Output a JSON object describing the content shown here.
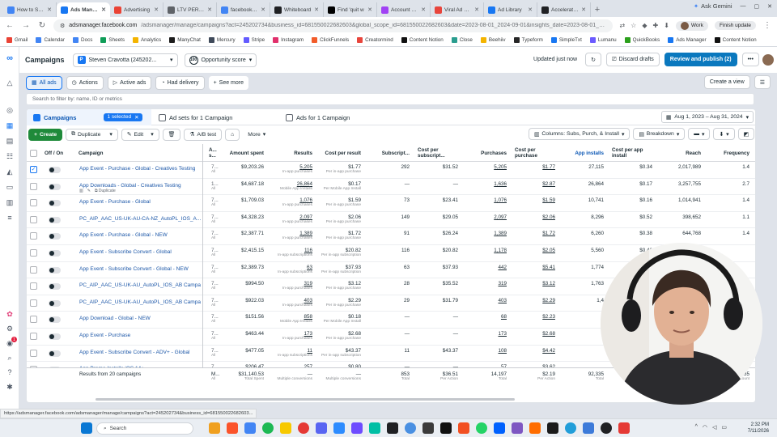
{
  "browser": {
    "tabs": [
      {
        "label": "How to Scale",
        "color": "#4285f4",
        "active": false
      },
      {
        "label": "Ads Manager",
        "color": "#1877f2",
        "active": true
      },
      {
        "label": "Advertising",
        "color": "#ea4335",
        "active": false
      },
      {
        "label": "LTV PER INS",
        "color": "#5f6368",
        "active": false
      },
      {
        "label": "facebook en",
        "color": "#4285f4",
        "active": false
      },
      {
        "label": "Whiteboard",
        "color": "#202124",
        "active": false
      },
      {
        "label": "Find 'quit w",
        "color": "#000000",
        "active": false
      },
      {
        "label": "Account Set",
        "color": "#a142f4",
        "active": false
      },
      {
        "label": "Viral Ad Libr",
        "color": "#e8453c",
        "active": false
      },
      {
        "label": "Ad Library",
        "color": "#1877f2",
        "active": false
      },
      {
        "label": "Accelerate y",
        "color": "#202124",
        "active": false
      }
    ],
    "ask_label": "Ask Gemini",
    "url_base": "adsmanager.facebook.com",
    "url_rest": "/adsmanager/manage/campaigns?act=245202734&business_id=681550022682603&global_scope_id=681550022682603&date=2023-08-01_2024-09-01&insights_date=2023-08-01_2024-08-31",
    "profile_label": "Work",
    "finish_label": "Finish update",
    "bookmarks": [
      {
        "label": "Gmail",
        "color": "#ea4335"
      },
      {
        "label": "Calendar",
        "color": "#4285f4"
      },
      {
        "label": "Docs",
        "color": "#4285f4"
      },
      {
        "label": "Sheets",
        "color": "#0f9d58"
      },
      {
        "label": "Analytics",
        "color": "#f4b400"
      },
      {
        "label": "ManyChat",
        "color": "#1c1c1c"
      },
      {
        "label": "Mercury",
        "color": "#3f4a5a"
      },
      {
        "label": "Stripe",
        "color": "#635bff"
      },
      {
        "label": "Instagram",
        "color": "#e1306c"
      },
      {
        "label": "ClickFunnels",
        "color": "#f25c2a"
      },
      {
        "label": "Creatormind",
        "color": "#e8453c"
      },
      {
        "label": "Content Notion",
        "color": "#111111"
      },
      {
        "label": "Close",
        "color": "#2a9d8f"
      },
      {
        "label": "Beehiiv",
        "color": "#f4b400"
      },
      {
        "label": "Typeform",
        "color": "#262627"
      },
      {
        "label": "SimpleTxt",
        "color": "#1877f2"
      },
      {
        "label": "Lumanu",
        "color": "#6b5bff"
      },
      {
        "label": "QuickBooks",
        "color": "#2ca01c"
      },
      {
        "label": "Ads Manager",
        "color": "#1877f2"
      },
      {
        "label": "Content Notion",
        "color": "#111111"
      }
    ]
  },
  "header": {
    "title": "Campaigns",
    "account": "Steven Cravotta (245202...",
    "opportunity": "Opportunity score",
    "opportunity_badge": "100",
    "updated": "Updated just now",
    "discard": "Discard drafts",
    "review": "Review and publish (2)"
  },
  "filters": {
    "tabs": [
      "All ads",
      "Actions",
      "Active ads",
      "Had delivery"
    ],
    "see_more": "See more",
    "create_view": "Create a view"
  },
  "search": {
    "placeholder": "Search to filter by: name, ID or metrics"
  },
  "levels": {
    "campaigns": "Campaigns",
    "selected": "1 selected",
    "adsets": "Ad sets for 1 Campaign",
    "ads": "Ads for 1 Campaign",
    "date_range": "Aug 1, 2023 – Aug 31, 2024"
  },
  "actions": {
    "create": "Create",
    "duplicate": "Duplicate",
    "edit": "Edit",
    "ab_test": "A/B test",
    "more": "More",
    "columns": "Columns: Subs, Purch, & Install",
    "breakdown": "Breakdown"
  },
  "table": {
    "headers": [
      "Off / On",
      "Campaign",
      "A... s...",
      "Amount spent",
      "Results",
      "Cost per result",
      "Subscript...",
      "Cost per subscript...",
      "Purchases",
      "Cost per purchase",
      "App installs",
      "Cost per app install",
      "Reach",
      "Frequency"
    ],
    "row_tools": [
      "Duplicate"
    ],
    "rows": [
      {
        "name": "App Event - Purchase - Global - Creatives Testing",
        "st": "7...",
        "st_sub": "All",
        "spent": "$9,203.26",
        "results": "5,205",
        "results_sub": "In-app purchases",
        "cpr": "$1.77",
        "cpr_sub": "Per in-app purchase",
        "subs": "292",
        "cps": "$31.52",
        "purch": "5,205",
        "cpp": "$1.77",
        "installs": "27,115",
        "cpi": "$0.34",
        "reach": "2,017,989",
        "freq": "1.4",
        "checked": true
      },
      {
        "name": "App Downloads - Global - Creatives Testing",
        "st": "1...",
        "st_sub": "All",
        "spent": "$4,687.18",
        "results": "26,864",
        "results_sub": "Mobile App Installs",
        "cpr": "$0.17",
        "cpr_sub": "Per Mobile App Install",
        "subs": "—",
        "cps": "—",
        "purch": "1,636",
        "cpp": "$2.87",
        "installs": "26,864",
        "cpi": "$0.17",
        "reach": "3,257,755",
        "freq": "2.7",
        "checked": false
      },
      {
        "name": "App Event - Purchase - Global",
        "st": "7...",
        "st_sub": "All",
        "spent": "$1,709.03",
        "results": "1,076",
        "results_sub": "In-app purchases",
        "cpr": "$1.59",
        "cpr_sub": "Per in-app purchase",
        "subs": "73",
        "cps": "$23.41",
        "purch": "1,076",
        "cpp": "$1.59",
        "installs": "10,741",
        "cpi": "$0.16",
        "reach": "1,014,941",
        "freq": "1.4",
        "checked": false
      },
      {
        "name": "PC_AIP_AAC_US-UK-AU-CA-NZ_AutoPL_IOS_A...",
        "st": "7...",
        "st_sub": "All",
        "spent": "$4,328.23",
        "results": "2,097",
        "results_sub": "In-app purchases",
        "cpr": "$2.06",
        "cpr_sub": "Per in-app purchase",
        "subs": "149",
        "cps": "$29.05",
        "purch": "2,097",
        "cpp": "$2.06",
        "installs": "8,296",
        "cpi": "$0.52",
        "reach": "398,652",
        "freq": "1.1",
        "checked": false
      },
      {
        "name": "App Event - Purchase - Global - NEW",
        "st": "7...",
        "st_sub": "All",
        "spent": "$2,387.71",
        "results": "1,389",
        "results_sub": "In-app purchases",
        "cpr": "$1.72",
        "cpr_sub": "Per in-app purchase",
        "subs": "91",
        "cps": "$26.24",
        "purch": "1,389",
        "cpp": "$1.72",
        "installs": "6,260",
        "cpi": "$0.38",
        "reach": "644,768",
        "freq": "1.4",
        "checked": false
      },
      {
        "name": "App Event - Subscribe Convert - Global",
        "st": "7...",
        "st_sub": "All",
        "spent": "$2,415.15",
        "results": "116",
        "results_sub": "In-app subscriptions",
        "cpr": "$20.82",
        "cpr_sub": "Per in-app subscription",
        "subs": "116",
        "cps": "$20.82",
        "purch": "1,178",
        "cpp": "$2.05",
        "installs": "5,560",
        "cpi": "$0.43",
        "reach": "",
        "freq": "",
        "checked": false
      },
      {
        "name": "App Event - Subscribe Convert - Global - NEW",
        "st": "7...",
        "st_sub": "All",
        "spent": "$2,389.73",
        "results": "63",
        "results_sub": "In-app subscriptions",
        "cpr": "$37.93",
        "cpr_sub": "Per in-app subscription",
        "subs": "63",
        "cps": "$37.93",
        "purch": "442",
        "cpp": "$5.41",
        "installs": "1,774",
        "cpi": "",
        "reach": "",
        "freq": "",
        "checked": false
      },
      {
        "name": "PC_AIP_AAC_US-UK-AU_AutoPL_IOS_AB Campaign",
        "st": "7...",
        "st_sub": "All",
        "spent": "$994.50",
        "results": "319",
        "results_sub": "In-app purchases",
        "cpr": "$3.12",
        "cpr_sub": "Per in-app purchase",
        "subs": "28",
        "cps": "$35.52",
        "purch": "319",
        "cpp": "$3.12",
        "installs": "1,763",
        "cpi": "",
        "reach": "",
        "freq": "",
        "checked": false
      },
      {
        "name": "PC_AIP_AAC_US-UK-AU_AutoPL_IOS_AB Campaign...",
        "st": "7...",
        "st_sub": "All",
        "spent": "$922.03",
        "results": "403",
        "results_sub": "In-app purchases",
        "cpr": "$2.29",
        "cpr_sub": "Per in-app purchase",
        "subs": "29",
        "cps": "$31.79",
        "purch": "403",
        "cpp": "$2.29",
        "installs": "1,4",
        "cpi": "",
        "reach": "",
        "freq": "",
        "checked": false
      },
      {
        "name": "App Download - Global - NEW",
        "st": "7...",
        "st_sub": "All",
        "spent": "$151.56",
        "results": "858",
        "results_sub": "Mobile App Installs",
        "cpr": "$0.18",
        "cpr_sub": "Per Mobile App Install",
        "subs": "—",
        "cps": "—",
        "purch": "68",
        "cpp": "$2.23",
        "installs": "",
        "cpi": "",
        "reach": "",
        "freq": "",
        "checked": false
      },
      {
        "name": "App Event - Purchase",
        "st": "7...",
        "st_sub": "All",
        "spent": "$463.44",
        "results": "173",
        "results_sub": "In-app purchases",
        "cpr": "$2.68",
        "cpr_sub": "Per in-app purchase",
        "subs": "—",
        "cps": "—",
        "purch": "173",
        "cpp": "$2.68",
        "installs": "",
        "cpi": "",
        "reach": "",
        "freq": "",
        "checked": false
      },
      {
        "name": "App Event - Subscribe Convert - ADV+ - Global",
        "st": "7...",
        "st_sub": "All",
        "spent": "$477.05",
        "results": "11",
        "results_sub": "In-app subscriptions",
        "cpr": "$43.37",
        "cpr_sub": "Per in-app subscription",
        "subs": "11",
        "cps": "$43.37",
        "purch": "108",
        "cpp": "$4.42",
        "installs": "",
        "cpi": "",
        "reach": "",
        "freq": "",
        "checked": false
      },
      {
        "name": "App Promo Installs iOS 14+",
        "st": "7...",
        "st_sub": "",
        "spent": "$206.47",
        "results": "257",
        "results_sub": "",
        "cpr": "$0.80",
        "cpr_sub": "",
        "subs": "—",
        "cps": "—",
        "purch": "57",
        "cpp": "$3.62",
        "installs": "",
        "cpi": "",
        "reach": "",
        "freq": "",
        "checked": false
      }
    ],
    "totals": {
      "label": "Results from 20 campaigns",
      "st": "M...",
      "st_sub": "All",
      "spent": "$31,140.53",
      "spent_sub": "Total Spent",
      "results": "—",
      "results_sub": "Multiple conversions",
      "cpr": "—",
      "cpr_sub": "Multiple conversions",
      "subs": "853",
      "subs_sub": "Total",
      "cps": "$36.51",
      "cps_sub": "Per Action",
      "purch": "14,197",
      "purch_sub": "Total",
      "cpp": "$2.19",
      "cpp_sub": "Per Action",
      "installs": "92,335",
      "installs_sub": "Total",
      "cpi": "",
      "reach": "",
      "freq": "2.85",
      "freq_sub": "Account"
    }
  },
  "status_url": "https://adsmanager.facebook.com/adsmanager/manage/campaigns?act=245202734&business_id=681550022682603...",
  "taskbar": {
    "search_label": "Search",
    "time": "2:32 PM",
    "date": "7/11/2026"
  }
}
